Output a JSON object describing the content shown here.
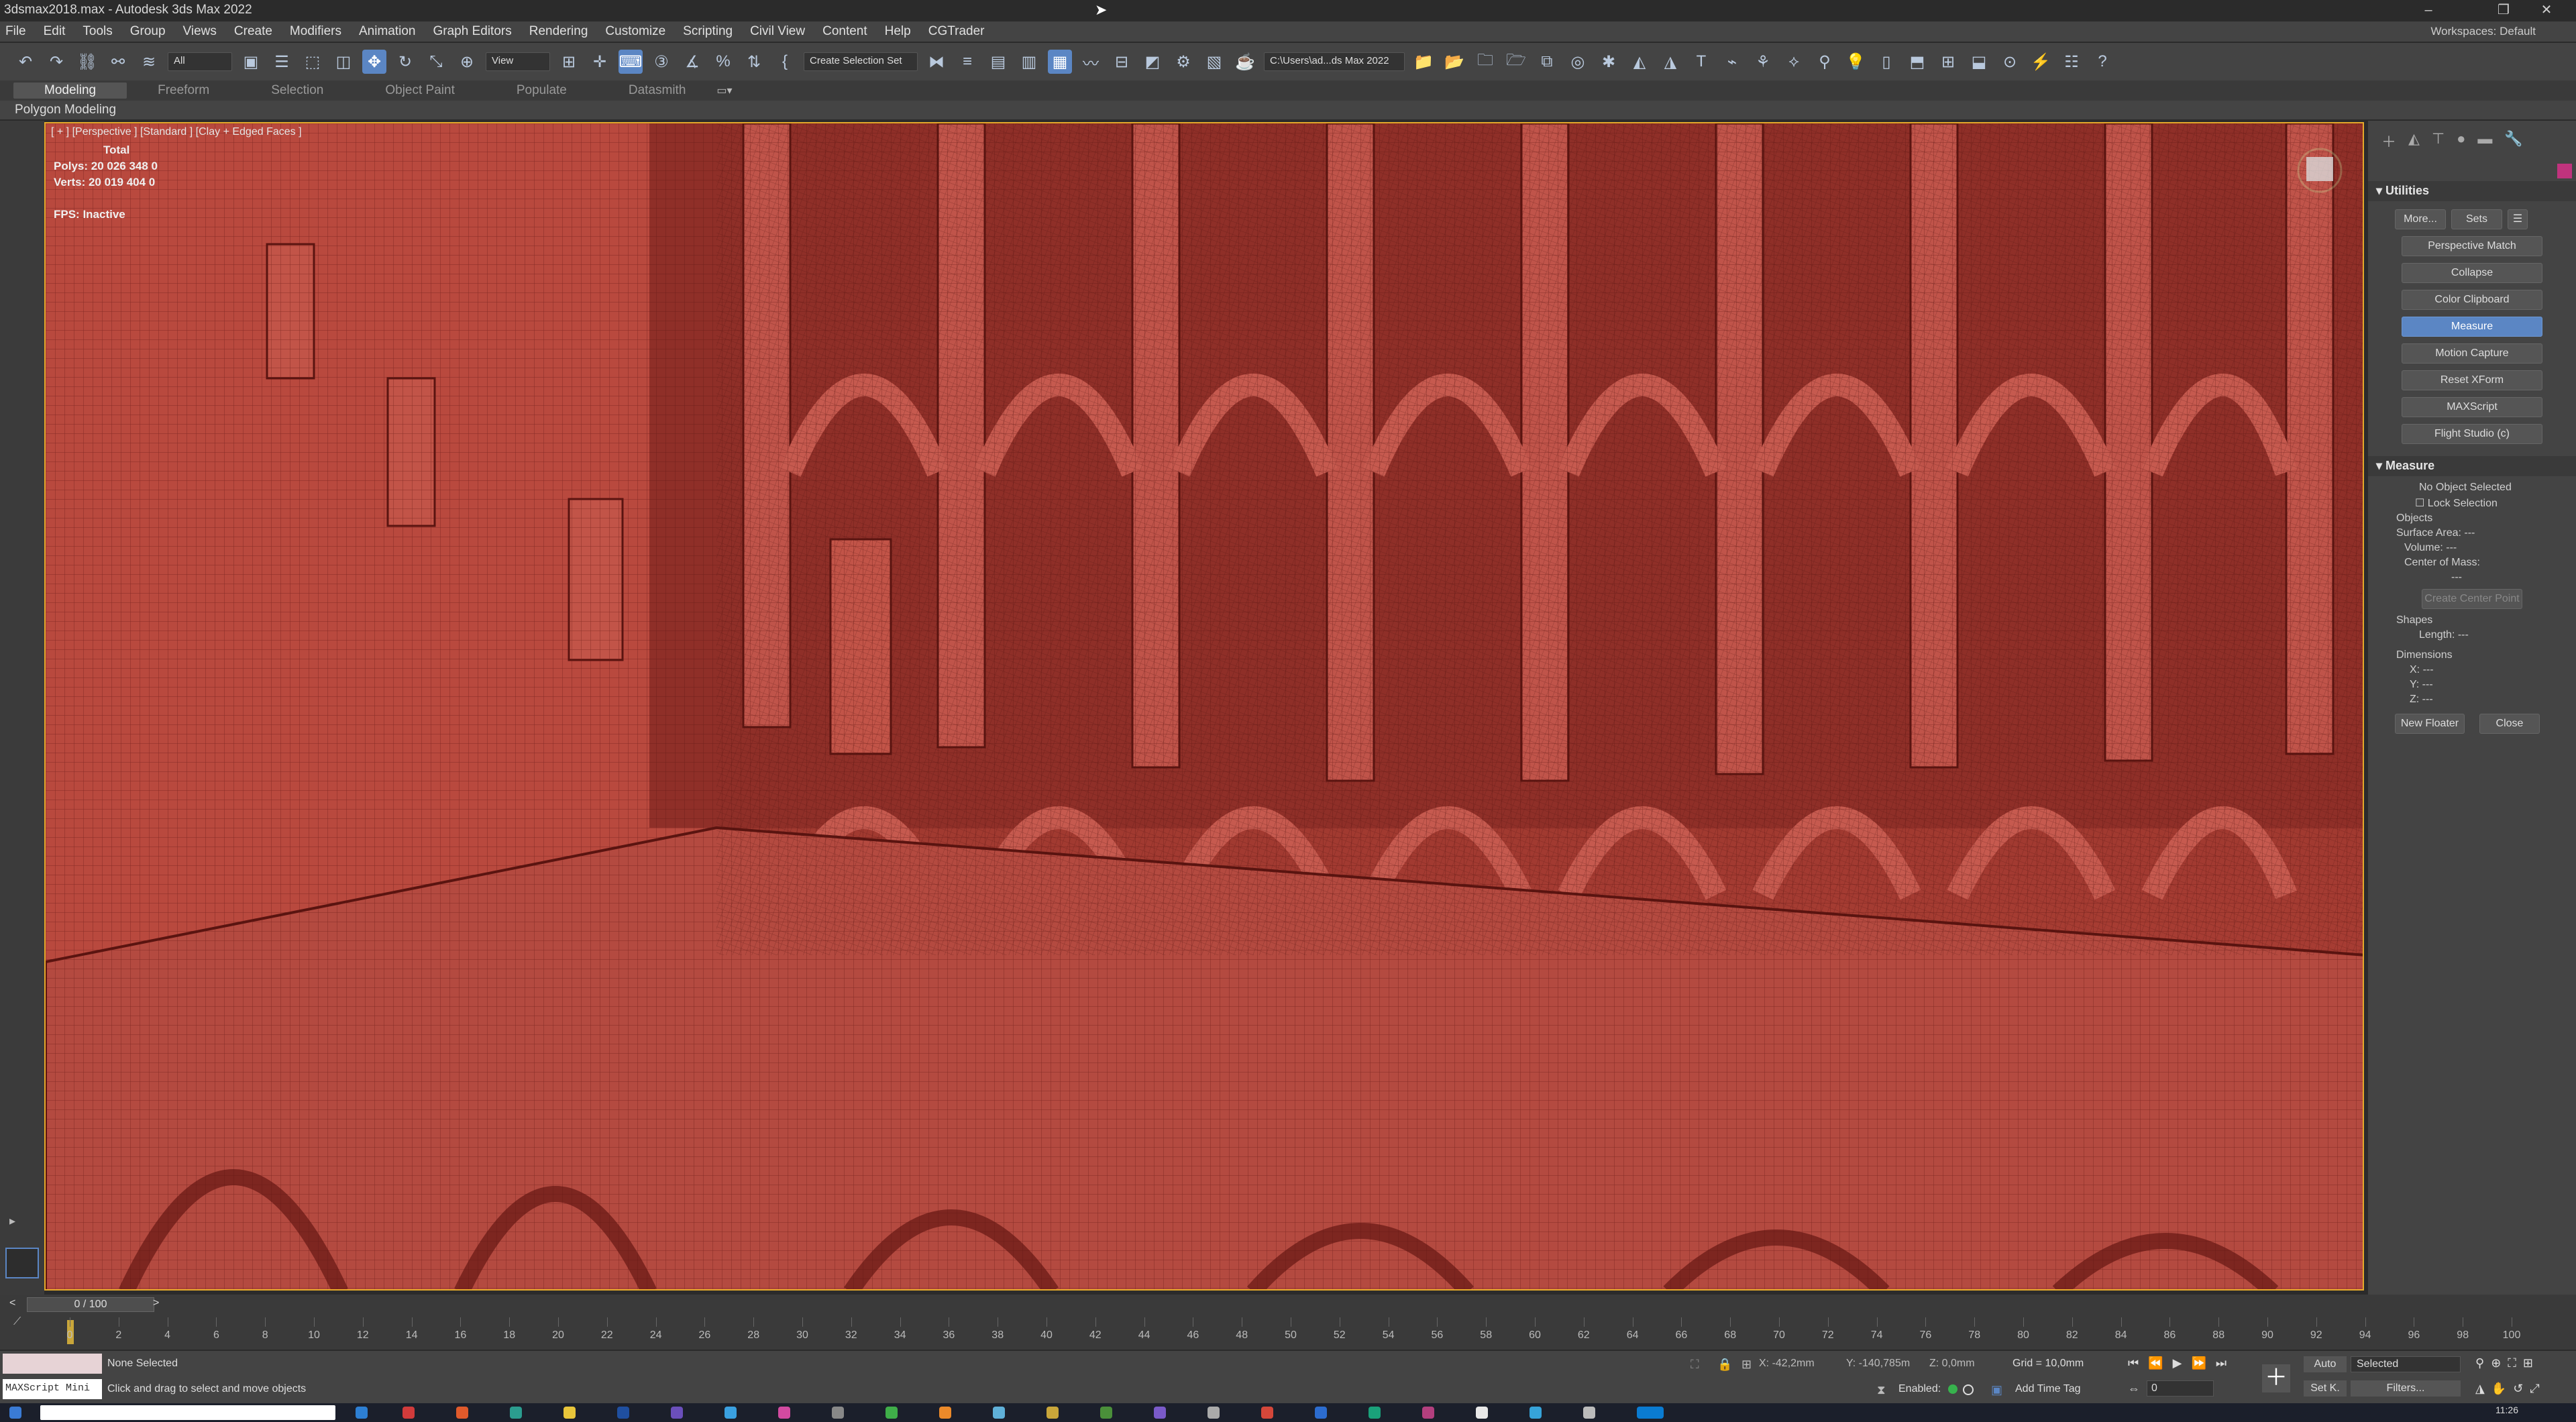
{
  "window": {
    "title": "3dsmax2018.max - Autodesk 3ds Max 2022",
    "workspaces_label": "Workspaces:",
    "workspaces_value": "Default"
  },
  "menu": [
    "File",
    "Edit",
    "Tools",
    "Group",
    "Views",
    "Create",
    "Modifiers",
    "Animation",
    "Graph Editors",
    "Rendering",
    "Customize",
    "Scripting",
    "Civil View",
    "Content",
    "Help",
    "CGTrader"
  ],
  "toolbar": {
    "selection_filter": "All",
    "reference_coord": "View",
    "named_selection": "Create Selection Set",
    "project_path": "C:\\Users\\ad...ds Max 2022"
  },
  "ribbon": {
    "tabs": [
      "Modeling",
      "Freeform",
      "Selection",
      "Object Paint",
      "Populate",
      "Datasmith"
    ],
    "active_tab": "Modeling",
    "sub_label": "Polygon Modeling"
  },
  "viewport": {
    "label": "[ + ] [Perspective ] [Standard ] [Clay + Edged Faces ]",
    "stats_header": "Total",
    "polys": "Polys:  20 026 348  0",
    "verts": "Verts:  20 019 404  0",
    "fps": "FPS:    Inactive",
    "color": "#a53a32"
  },
  "command_panel": {
    "utilities_title": "Utilities",
    "more_button": "More...",
    "sets_button": "Sets",
    "utility_buttons": [
      "Perspective Match",
      "Collapse",
      "Color Clipboard",
      "Measure",
      "Motion Capture",
      "Reset XForm",
      "MAXScript",
      "Flight Studio (c)"
    ],
    "active_utility": "Measure",
    "measure": {
      "title": "Measure",
      "no_object": "No Object Selected",
      "lock_selection": "Lock Selection",
      "objects_label": "Objects",
      "surface_area": "Surface Area:  ---",
      "volume": "Volume:  ---",
      "center_of_mass": "Center of Mass:",
      "center_value": "---",
      "create_center_point": "Create Center Point",
      "shapes_label": "Shapes",
      "length": "Length:  ---",
      "dimensions_label": "Dimensions",
      "x": "X:  ---",
      "y": "Y:  ---",
      "z": "Z:  ---",
      "new_floater": "New Floater",
      "close": "Close"
    }
  },
  "timeline": {
    "frame_display": "0 / 100",
    "ticks": [
      "0",
      "2",
      "4",
      "6",
      "8",
      "10",
      "12",
      "14",
      "16",
      "18",
      "20",
      "22",
      "24",
      "26",
      "28",
      "30",
      "32",
      "34",
      "36",
      "38",
      "40",
      "42",
      "44",
      "46",
      "48",
      "50",
      "52",
      "54",
      "56",
      "58",
      "60",
      "62",
      "64",
      "66",
      "68",
      "70",
      "72",
      "74",
      "76",
      "78",
      "80",
      "82",
      "84",
      "86",
      "88",
      "90",
      "92",
      "94",
      "96",
      "98",
      "100"
    ]
  },
  "status": {
    "selection": "None Selected",
    "prompt": "Click and drag to select and move objects",
    "maxscript": "MAXScript Mini",
    "x": "X: -42,2mm",
    "y": "Y: -140,785m",
    "z": "Z: 0,0mm",
    "grid": "Grid = 10,0mm",
    "enabled": "Enabled:",
    "add_time_tag": "Add Time Tag",
    "auto": "Auto",
    "set_key": "Set K.",
    "key_filter": "Selected",
    "filters": "Filters...",
    "current_frame": "0",
    "clock": "11:26"
  }
}
